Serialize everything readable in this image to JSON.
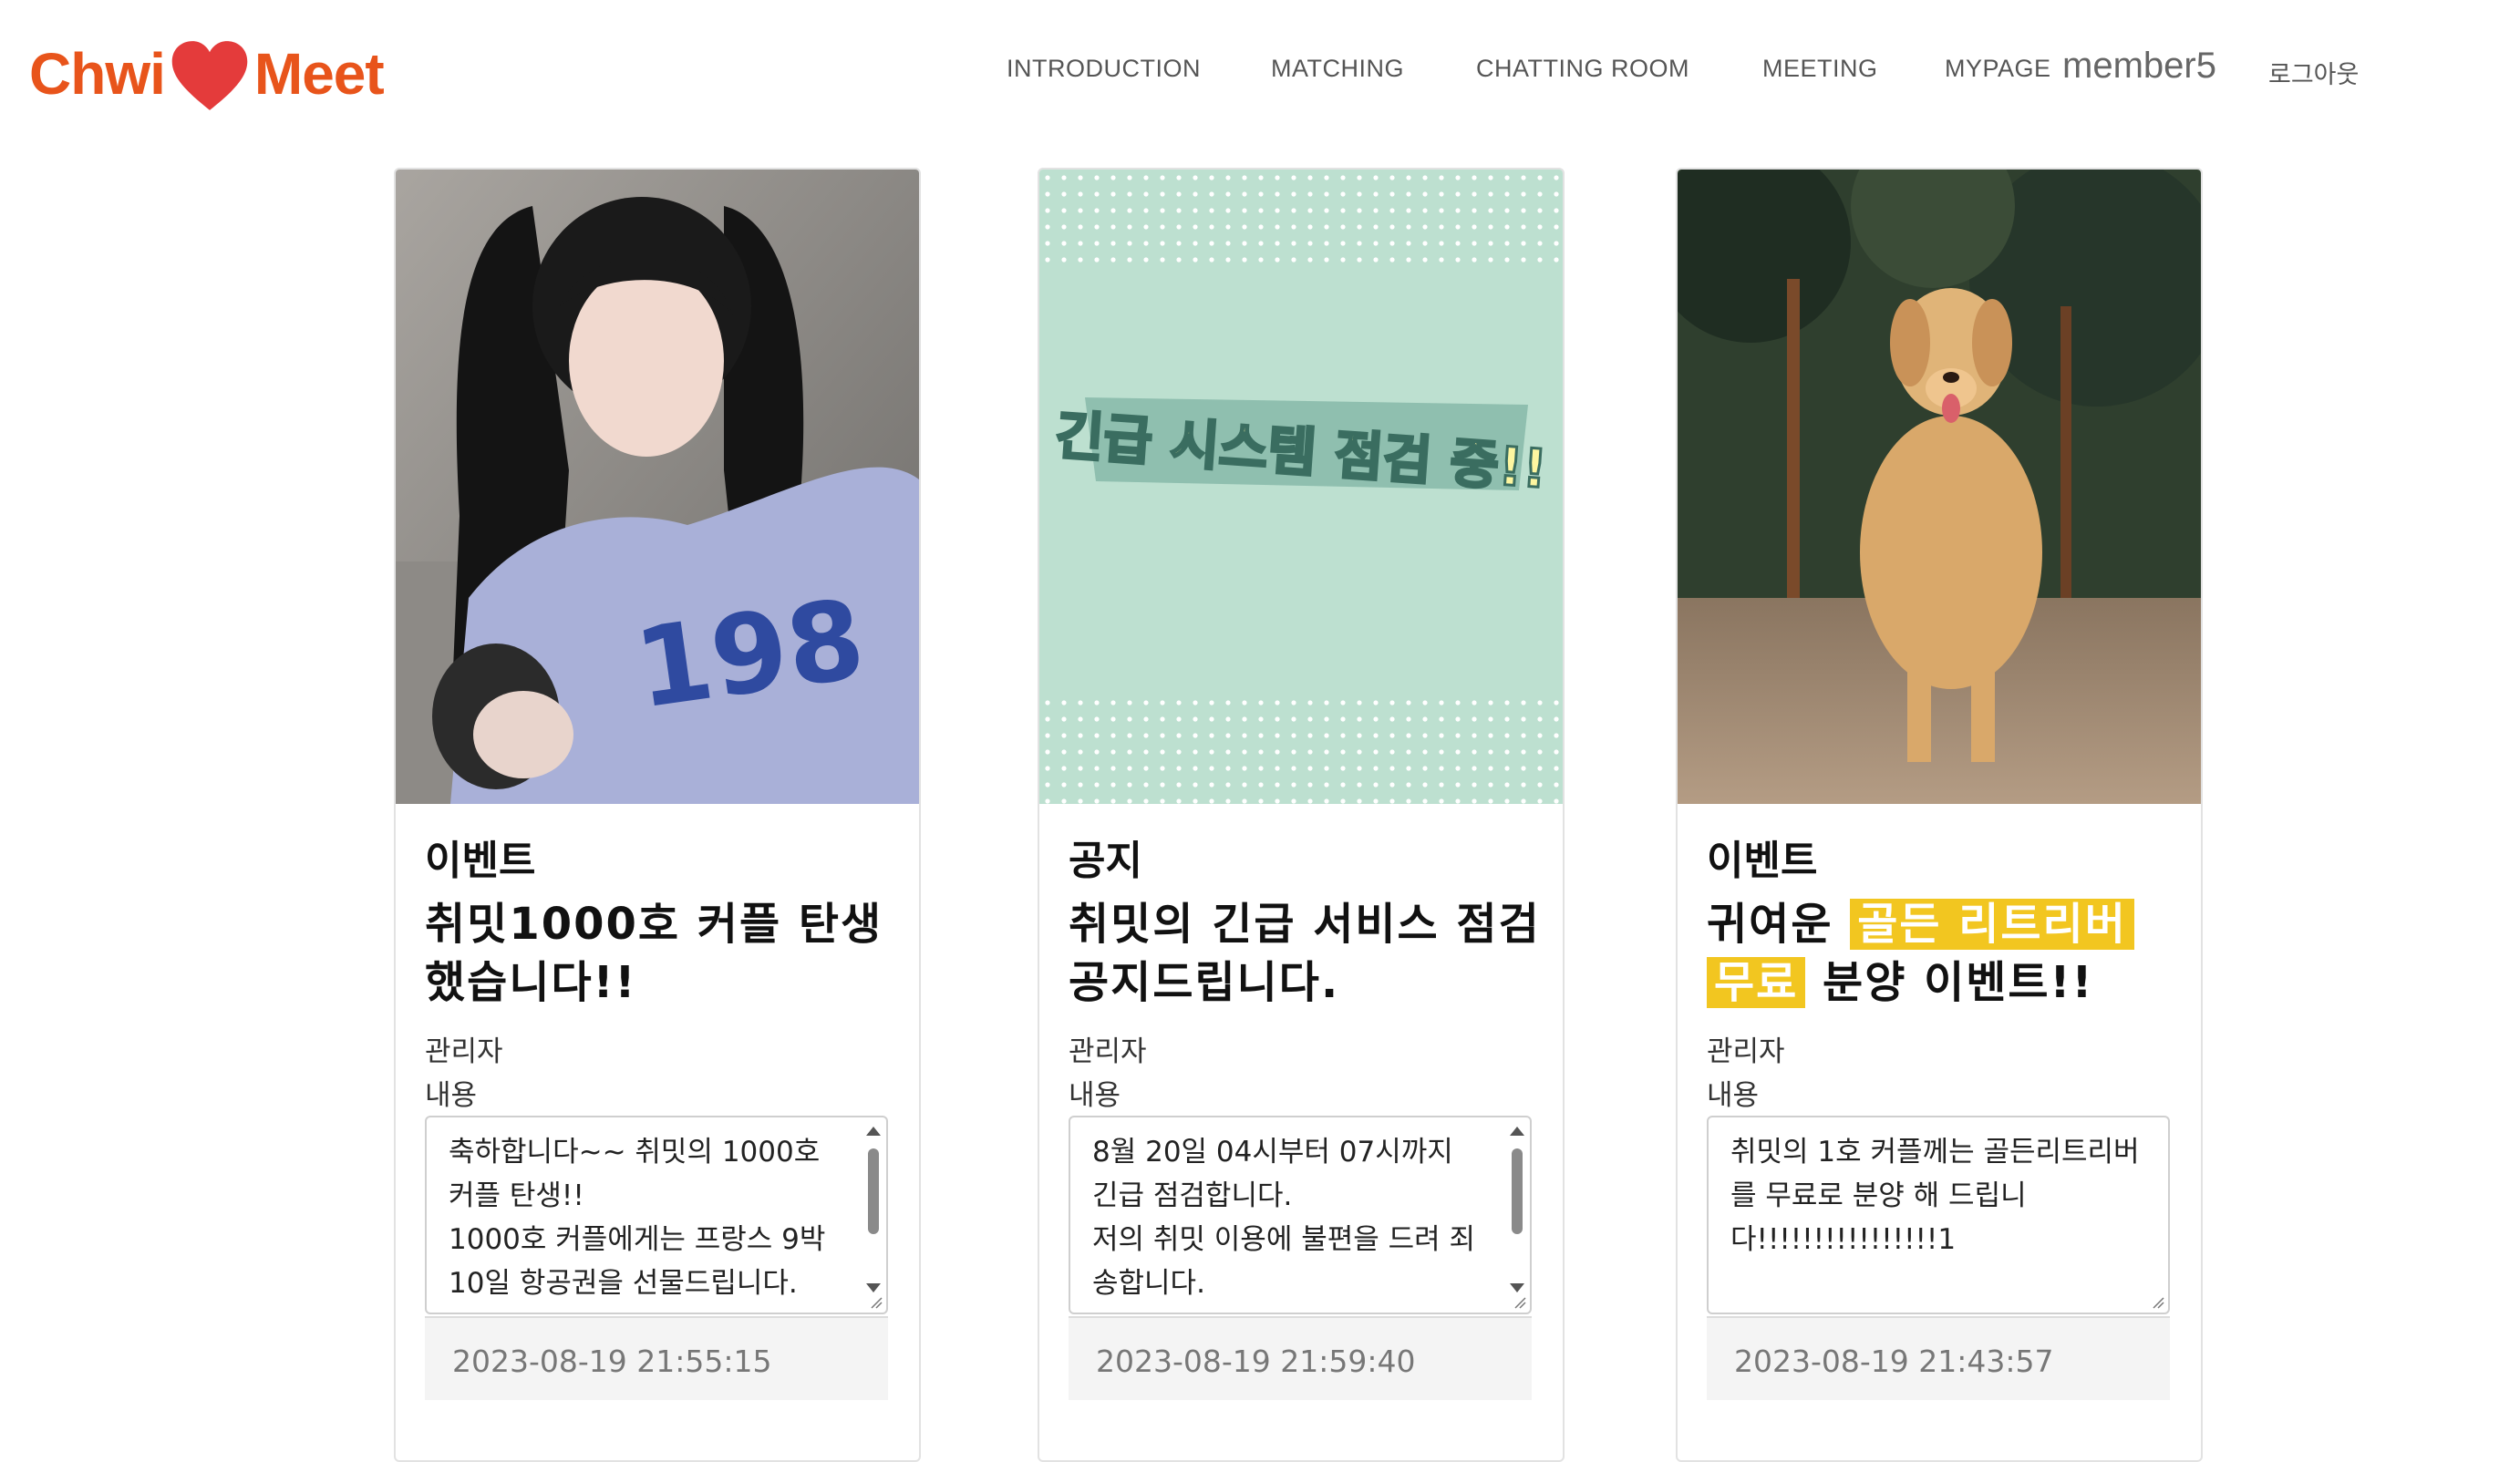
{
  "brand": {
    "name_left": "Chwi",
    "name_right": "Meet",
    "accent": "#e8541b"
  },
  "nav": {
    "items": [
      "INTRODUCTION",
      "MATCHING",
      "CHATTING ROOM",
      "MEETING",
      "MYPAGE"
    ],
    "username": "member5",
    "logout": "로그아웃"
  },
  "cards": [
    {
      "image_icon": "photo-woman",
      "category": "이벤트",
      "title": "취밋1000호 커플 탄생했습니다!!",
      "author": "관리자",
      "content_label": "내용",
      "content": "축하합니다~~ 취밋의 1000호 커플 탄생!!\n1000호 커플에게는 프랑스 9박10일 항공권을 선물드립니다.",
      "date": "2023-08-19 21:55:15",
      "scrollbar": true
    },
    {
      "image_icon": "system-maintenance-banner",
      "image_text": "긴급 시스템 점검 중!!",
      "category": "공지",
      "title": "취밋의 긴급 서비스 점검 공지드립니다.",
      "author": "관리자",
      "content_label": "내용",
      "content": "8월 20일 04시부터 07시까지 긴급 점검합니다.\n저의 취밋 이용에 불편을 드려 죄송합니다.",
      "date": "2023-08-19 21:59:40",
      "scrollbar": true
    },
    {
      "image_icon": "photo-golden-retriever",
      "category": "이벤트",
      "title_pre": "귀여운",
      "title_hl1": "골든 리트리버",
      "title_hl2": "무료",
      "title_post": "분양 이벤트!!",
      "author": "관리자",
      "content_label": "내용",
      "content": "취밋의 1호 커플께는 골든리트리버를 무료로 분양 해 드립니다!!!!!!!!!!!!!!!!1",
      "date": "2023-08-19 21:43:57",
      "scrollbar": false
    }
  ]
}
